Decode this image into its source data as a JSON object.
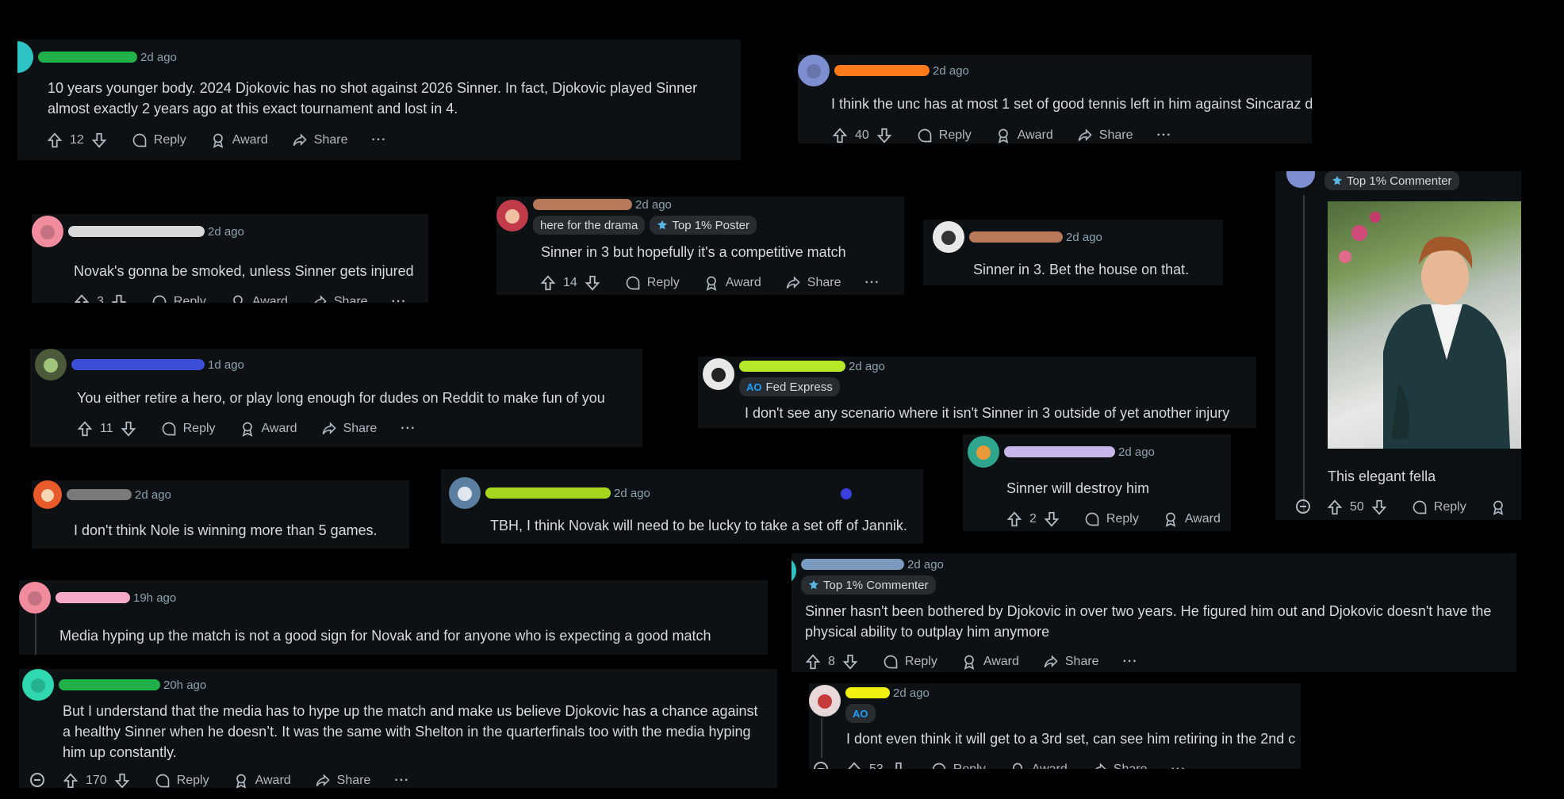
{
  "icons": {
    "upvote": "arrow-up-icon",
    "downvote": "arrow-down-icon",
    "reply": "speech-bubble-icon",
    "award": "award-ribbon-icon",
    "share": "share-arrow-icon",
    "more": "ellipsis-icon",
    "collapse": "collapse-minus-icon"
  },
  "colors": {
    "background": "#000000",
    "card": "#0e1113",
    "text": "#d7dadc",
    "meta": "#8ba2ad",
    "flair_bg": "#272c30",
    "ao_blue": "#1a9fff"
  },
  "labels": {
    "reply": "Reply",
    "award": "Award",
    "share": "Share",
    "more": "···"
  },
  "comments": {
    "c1": {
      "time": "2d ago",
      "text": "10 years younger body. 2024 Djokovic has no shot against 2026 Sinner. In fact, Djokovic played Sinner almost exactly 2 years ago at this exact tournament and lost in 4.",
      "score": "12"
    },
    "c2": {
      "time": "2d ago",
      "text": "I think the unc has at most 1 set of good tennis left in him against Sincaraz d",
      "score": "40"
    },
    "c3": {
      "time": "2d ago",
      "text": "Novak's gonna be smoked, unless Sinner gets injured",
      "score": "3"
    },
    "c4": {
      "time": "2d ago",
      "flair1": "here for the drama",
      "flair2": "Top 1% Poster",
      "text": "Sinner in 3 but hopefully it's a competitive match",
      "score": "14"
    },
    "c5": {
      "time": "2d ago",
      "text": "Sinner in 3. Bet the house on that."
    },
    "c6": {
      "flair": "Top 1% Commenter",
      "text": "This elegant fella",
      "score": "50"
    },
    "c7": {
      "time": "1d ago",
      "text": "You either retire a hero, or play long enough for dudes on Reddit to make fun of you",
      "score": "11"
    },
    "c8": {
      "time": "2d ago",
      "flair": "Fed Express",
      "text": "I don't see any scenario where it isn't Sinner in 3 outside of yet another injury"
    },
    "c9": {
      "time": "2d ago",
      "text": "Sinner will destroy him",
      "score": "2"
    },
    "c10": {
      "time": "2d ago",
      "text": "I don't think Nole is winning more than 5 games."
    },
    "c11": {
      "time": "2d ago",
      "text": "TBH, I think Novak will need to be lucky to take a set off of Jannik."
    },
    "c12": {
      "time": "2d ago",
      "flair": "Top 1% Commenter",
      "text": "Sinner hasn't been bothered by Djokovic in over two years. He figured him out and Djokovic doesn't have the physical ability to outplay him anymore",
      "score": "8"
    },
    "c13": {
      "time": "19h ago",
      "text": "Media hyping up the match is not a good sign for Novak and for anyone who is expecting a good match"
    },
    "c14": {
      "time": "20h ago",
      "text": "But I understand that the media has to hype up the match and make us believe Djokovic has a chance against a healthy Sinner when he doesn’t. It was the same with Shelton in the quarterfinals too with the media hyping him up constantly.",
      "score": "170"
    },
    "c15": {
      "time": "2d ago",
      "flair": "AO",
      "text": "I dont even think it will get to a 3rd set, can see him retiring in the 2nd c",
      "score": "53"
    }
  }
}
